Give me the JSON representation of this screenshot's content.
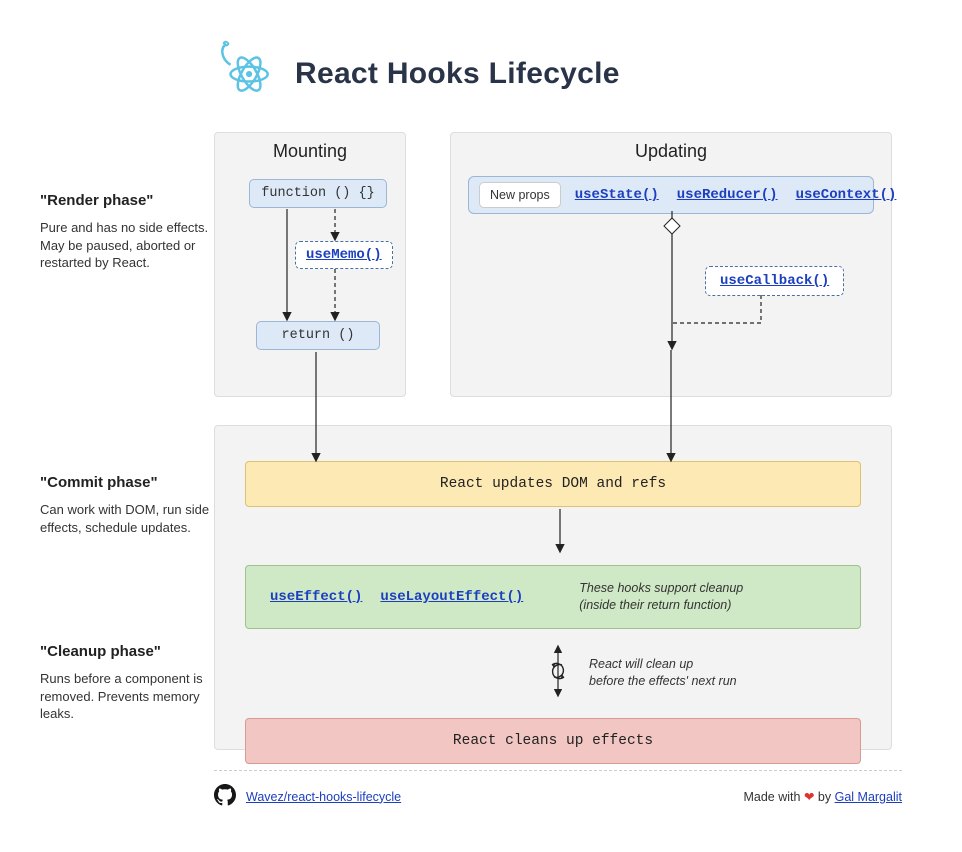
{
  "header": {
    "title": "React Hooks Lifecycle"
  },
  "phases": {
    "render": {
      "title": "\"Render phase\"",
      "desc": "Pure and has no side effects. May be paused, aborted or restarted by React."
    },
    "commit": {
      "title": "\"Commit phase\"",
      "desc": "Can work with DOM, run side effects, schedule updates."
    },
    "cleanup": {
      "title": "\"Cleanup phase\"",
      "desc": "Runs before a component is removed. Prevents memory leaks."
    }
  },
  "mounting": {
    "title": "Mounting",
    "function_label": "function () {}",
    "useMemo": "useMemo()",
    "return_label": "return ()"
  },
  "updating": {
    "title": "Updating",
    "new_props": "New props",
    "useState": "useState()",
    "useReducer": "useReducer()",
    "useContext": "useContext()",
    "useCallback": "useCallback()"
  },
  "commit": {
    "updates_dom": "React updates DOM and refs",
    "useEffect": "useEffect()",
    "useLayoutEffect": "useLayoutEffect()",
    "hooks_note_l1": "These hooks support cleanup",
    "hooks_note_l2": "(inside their return function)",
    "cycle_note_l1": "React will clean up",
    "cycle_note_l2": "before the effects' next run",
    "cleans_up": "React cleans up effects"
  },
  "footer": {
    "repo": "Wavez/react-hooks-lifecycle",
    "made_with": "Made with",
    "by": "by",
    "author": "Gal Margalit"
  }
}
